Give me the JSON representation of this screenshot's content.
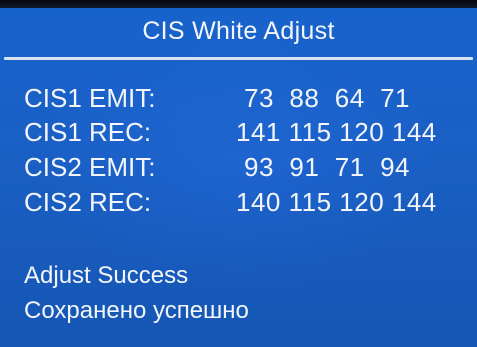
{
  "title": "CIS White Adjust",
  "rows": [
    {
      "label": "CIS1 EMIT:",
      "values": "73  88  64  71"
    },
    {
      "label": "CIS1 REC:",
      "values": "141 115 120 144"
    },
    {
      "label": "CIS2 EMIT:",
      "values": "93  91  71  94"
    },
    {
      "label": "CIS2 REC:",
      "values": "140 115 120 144"
    }
  ],
  "status": {
    "english": "Adjust Success",
    "russian": "Сохранено успешно"
  },
  "colors": {
    "background": "#1a5fc4",
    "text": "#f4f6fb",
    "divider": "#d9e2f2"
  }
}
